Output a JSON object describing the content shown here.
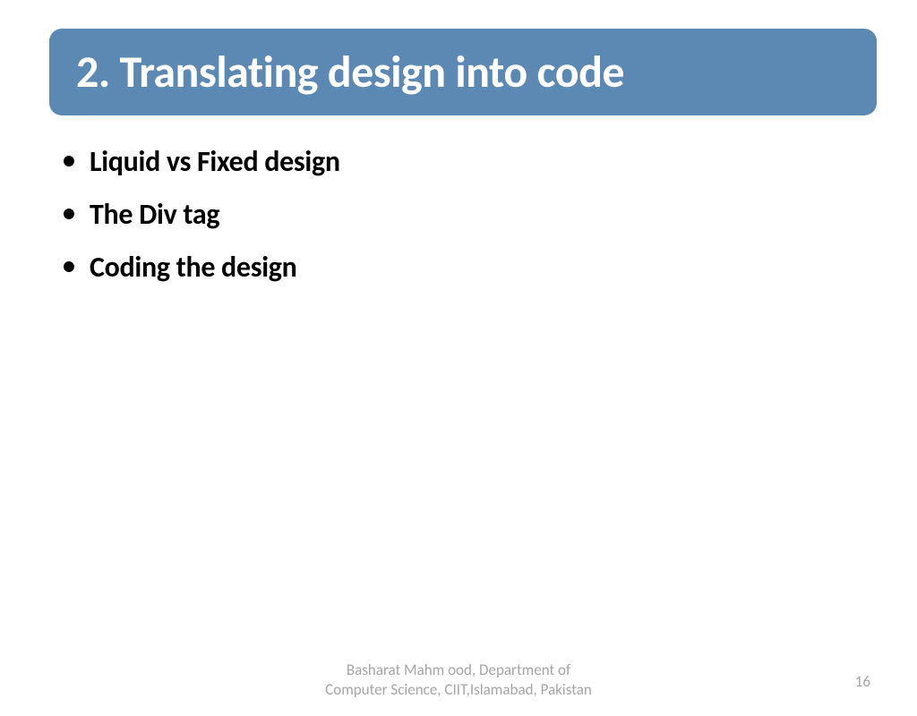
{
  "title": "2. Translating design into code",
  "bullets": [
    "Liquid vs Fixed design",
    "The Div tag",
    "Coding the design"
  ],
  "footer": {
    "line1": "Basharat Mahm ood, Department of",
    "line2": "Computer Science, CIIT,Islamabad, Pakistan"
  },
  "pageNumber": "16",
  "colors": {
    "banner": "#5b89b4",
    "bannerText": "#ffffff",
    "bodyText": "#000000",
    "footerText": "#a6a6a6"
  }
}
